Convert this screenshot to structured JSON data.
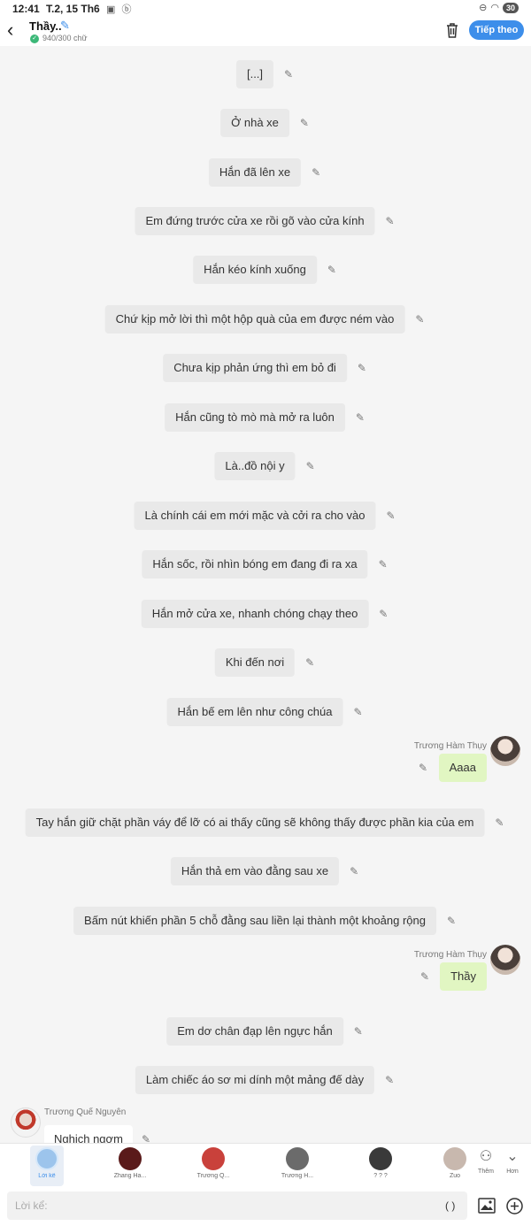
{
  "status_bar": {
    "time": "12:41",
    "date": "T.2, 15 Th6",
    "status_icons": "▣ ⓑ",
    "battery": "30"
  },
  "header": {
    "title": "Thầy..",
    "word_count": "940/300 chữ",
    "next_label": "Tiếp theo"
  },
  "messages": [
    {
      "text": "[...]"
    },
    {
      "text": "Ở nhà xe"
    },
    {
      "text": "Hắn đã lên xe"
    },
    {
      "text": "Em đứng trước cửa xe rồi gõ vào cửa kính"
    },
    {
      "text": "Hắn kéo kính xuống"
    },
    {
      "text": "Chứ kịp mở lời thì một hộp quà của em được ném vào"
    },
    {
      "text": "Chưa kịp phản ứng thì em bỏ đi"
    },
    {
      "text": "Hắn cũng tò mò mà mở ra luôn"
    },
    {
      "text": "Là..đồ nội y"
    },
    {
      "text": "Là chính cái em mới mặc và cởi ra cho vào"
    },
    {
      "text": "Hắn sốc, rồi nhìn bóng em đang đi ra xa"
    },
    {
      "text": "Hắn mở cửa xe, nhanh chóng chạy theo"
    },
    {
      "text": "Khi đến nơi"
    },
    {
      "text": "Hắn bế em lên như công chúa"
    },
    {
      "speaker": "Trương Hàm Thụy",
      "text": "Aaaa"
    },
    {
      "text": "Tay hắn giữ chặt phần váy để lỡ có ai thấy cũng sẽ không thấy được phần kia của em"
    },
    {
      "text": "Hắn thả em vào đằng sau xe"
    },
    {
      "text": "Bấm nút khiến phần 5 chỗ đằng sau liền lại thành một khoảng rộng"
    },
    {
      "speaker": "Trương Hàm Thụy",
      "text": "Thầy"
    },
    {
      "text": "Em dơ chân đạp lên ngực hắn"
    },
    {
      "text": "Làm chiếc áo sơ mi dính một mảng đế dày"
    },
    {
      "speaker": "Trương Quế Nguyên",
      "text": "Nghịch ngợm"
    }
  ],
  "characters": [
    {
      "name": "Lời kể",
      "active": true
    },
    {
      "name": "Zhang Ha...",
      "color": "#5a1a1a"
    },
    {
      "name": "Trương Q...",
      "color": "#c9413b"
    },
    {
      "name": "Trương H...",
      "color": "#6b6b6b"
    },
    {
      "name": "? ? ?",
      "color": "#3a3a3a"
    },
    {
      "name": "Zuo",
      "color": "#c8b8ae"
    }
  ],
  "side_buttons": {
    "more": "Thêm",
    "collapse": "Hơn"
  },
  "input": {
    "placeholder": "Lời kể:",
    "paren": "( )"
  }
}
